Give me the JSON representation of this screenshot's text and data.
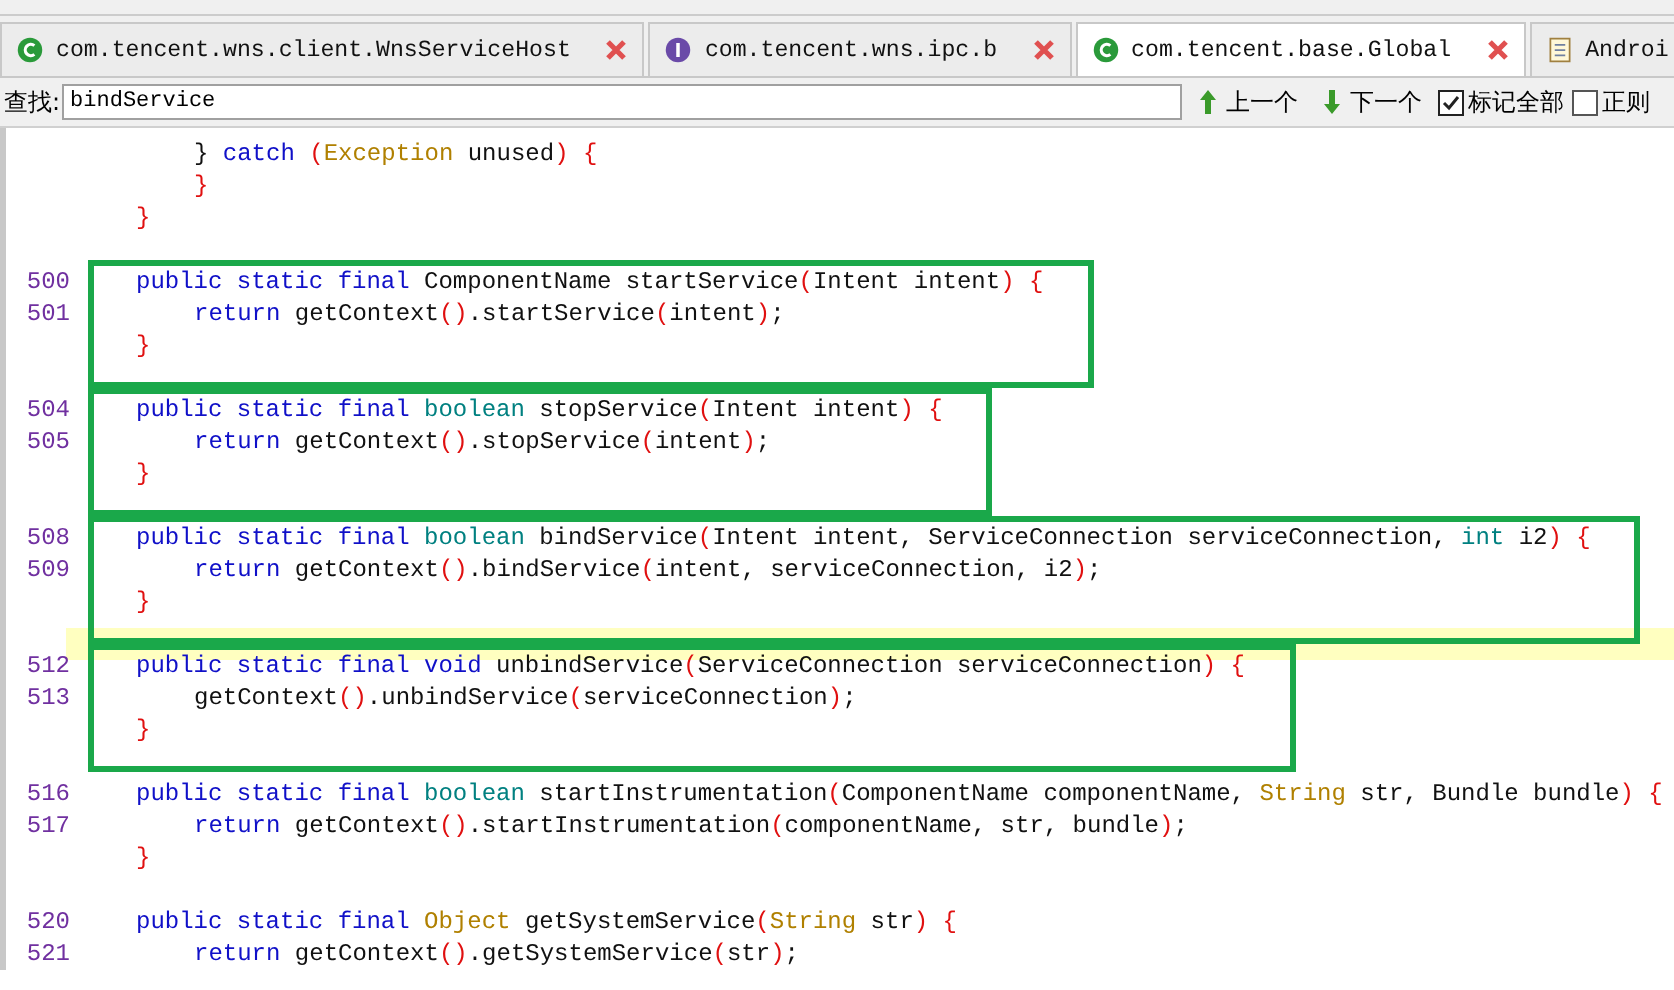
{
  "tabs": [
    {
      "label": "com.tencent.wns.client.WnsServiceHost",
      "kind": "class",
      "selected": false
    },
    {
      "label": "com.tencent.wns.ipc.b",
      "kind": "interface",
      "selected": false
    },
    {
      "label": "com.tencent.base.Global",
      "kind": "class",
      "selected": true
    },
    {
      "label": "Androi",
      "kind": "file",
      "selected": false
    }
  ],
  "search": {
    "label": "查找:",
    "value": "bindService",
    "prev": "上一个",
    "next": "下一个",
    "options": [
      {
        "label": "标记全部",
        "checked": true
      },
      {
        "label": "正则",
        "checked": false
      }
    ]
  },
  "code": [
    {
      "boxed": false,
      "lines": [
        {
          "indented": true,
          "tokens": [
            {
              "kind": "plain",
              "text": "} "
            },
            {
              "kind": "kw",
              "text": "catch"
            },
            {
              "kind": "paren",
              "text": " ("
            },
            {
              "kind": "ref",
              "text": "Exception"
            },
            {
              "kind": "plain",
              "text": " unused"
            },
            {
              "kind": "paren",
              "text": ")"
            },
            {
              "kind": "paren",
              "text": " {"
            }
          ]
        },
        {
          "indented": true,
          "tokens": [
            {
              "kind": "paren",
              "text": "}"
            }
          ]
        },
        {
          "indented": false,
          "tokens": [
            {
              "kind": "paren",
              "text": "}"
            }
          ]
        }
      ]
    },
    {
      "boxed": true,
      "lines": [
        {
          "number": "500",
          "indented": false,
          "tokens": [
            {
              "kind": "kw",
              "text": "public static final"
            },
            {
              "kind": "plain",
              "text": " ComponentName startService"
            },
            {
              "kind": "paren",
              "text": "("
            },
            {
              "kind": "plain",
              "text": "Intent intent"
            },
            {
              "kind": "paren",
              "text": ")"
            },
            {
              "kind": "paren",
              "text": " {"
            }
          ]
        },
        {
          "number": "501",
          "indented": true,
          "tokens": [
            {
              "kind": "kw",
              "text": "return"
            },
            {
              "kind": "plain",
              "text": " getContext"
            },
            {
              "kind": "paren",
              "text": "()"
            },
            {
              "kind": "plain",
              "text": ".startService"
            },
            {
              "kind": "paren",
              "text": "("
            },
            {
              "kind": "plain",
              "text": "intent"
            },
            {
              "kind": "paren",
              "text": ")"
            },
            {
              "kind": "plain",
              "text": ";"
            }
          ]
        },
        {
          "indented": false,
          "tokens": [
            {
              "kind": "paren",
              "text": "}"
            }
          ]
        }
      ]
    },
    {
      "boxed": true,
      "lines": [
        {
          "number": "504",
          "indented": false,
          "tokens": [
            {
              "kind": "kw",
              "text": "public static final"
            },
            {
              "kind": "prim",
              "text": " boolean"
            },
            {
              "kind": "plain",
              "text": " stopService"
            },
            {
              "kind": "paren",
              "text": "("
            },
            {
              "kind": "plain",
              "text": "Intent intent"
            },
            {
              "kind": "paren",
              "text": ")"
            },
            {
              "kind": "paren",
              "text": " {"
            }
          ]
        },
        {
          "number": "505",
          "indented": true,
          "tokens": [
            {
              "kind": "kw",
              "text": "return"
            },
            {
              "kind": "plain",
              "text": " getContext"
            },
            {
              "kind": "paren",
              "text": "()"
            },
            {
              "kind": "plain",
              "text": ".stopService"
            },
            {
              "kind": "paren",
              "text": "("
            },
            {
              "kind": "plain",
              "text": "intent"
            },
            {
              "kind": "paren",
              "text": ")"
            },
            {
              "kind": "plain",
              "text": ";"
            }
          ]
        },
        {
          "indented": false,
          "tokens": [
            {
              "kind": "paren",
              "text": "}"
            }
          ]
        }
      ]
    },
    {
      "boxed": true,
      "lines": [
        {
          "number": "508",
          "indented": false,
          "tokens": [
            {
              "kind": "kw",
              "text": "public static final"
            },
            {
              "kind": "prim",
              "text": " boolean"
            },
            {
              "kind": "plain",
              "text": " bindService"
            },
            {
              "kind": "paren",
              "text": "("
            },
            {
              "kind": "plain",
              "text": "Intent intent, ServiceConnection serviceConnection, "
            },
            {
              "kind": "prim",
              "text": "int"
            },
            {
              "kind": "plain",
              "text": " i2"
            },
            {
              "kind": "paren",
              "text": ")"
            },
            {
              "kind": "paren",
              "text": " {"
            }
          ]
        },
        {
          "number": "509",
          "indented": true,
          "tokens": [
            {
              "kind": "kw",
              "text": "return"
            },
            {
              "kind": "plain",
              "text": " getContext"
            },
            {
              "kind": "paren",
              "text": "()"
            },
            {
              "kind": "plain",
              "text": ".bindService"
            },
            {
              "kind": "paren",
              "text": "("
            },
            {
              "kind": "plain",
              "text": "intent, serviceConnection, i2"
            },
            {
              "kind": "paren",
              "text": ")"
            },
            {
              "kind": "plain",
              "text": ";"
            }
          ]
        },
        {
          "indented": false,
          "tokens": [
            {
              "kind": "paren",
              "text": "}"
            }
          ]
        }
      ]
    },
    {
      "highlighted": true
    },
    {
      "boxed": true,
      "lines": [
        {
          "number": "512",
          "indented": false,
          "tokens": [
            {
              "kind": "kw",
              "text": "public static final void"
            },
            {
              "kind": "plain",
              "text": " unbindService"
            },
            {
              "kind": "paren",
              "text": "("
            },
            {
              "kind": "plain",
              "text": "ServiceConnection serviceConnection"
            },
            {
              "kind": "paren",
              "text": ")"
            },
            {
              "kind": "paren",
              "text": " {"
            }
          ]
        },
        {
          "number": "513",
          "indented": true,
          "tokens": [
            {
              "kind": "plain",
              "text": "getContext"
            },
            {
              "kind": "paren",
              "text": "()"
            },
            {
              "kind": "plain",
              "text": ".unbindService"
            },
            {
              "kind": "paren",
              "text": "("
            },
            {
              "kind": "plain",
              "text": "serviceConnection"
            },
            {
              "kind": "paren",
              "text": ")"
            },
            {
              "kind": "plain",
              "text": ";"
            }
          ]
        },
        {
          "indented": false,
          "tokens": [
            {
              "kind": "paren",
              "text": "}"
            }
          ]
        }
      ]
    },
    {
      "boxed": false,
      "lines": [
        {
          "number": "516",
          "indented": false,
          "tokens": [
            {
              "kind": "kw",
              "text": "public static final"
            },
            {
              "kind": "prim",
              "text": " boolean"
            },
            {
              "kind": "plain",
              "text": " startInstrumentation"
            },
            {
              "kind": "paren",
              "text": "("
            },
            {
              "kind": "plain",
              "text": "ComponentName componentName, "
            },
            {
              "kind": "ref",
              "text": "String"
            },
            {
              "kind": "plain",
              "text": " str, Bundle bundle"
            },
            {
              "kind": "paren",
              "text": ")"
            },
            {
              "kind": "paren",
              "text": " {"
            }
          ]
        },
        {
          "number": "517",
          "indented": true,
          "tokens": [
            {
              "kind": "kw",
              "text": "return"
            },
            {
              "kind": "plain",
              "text": " getContext"
            },
            {
              "kind": "paren",
              "text": "()"
            },
            {
              "kind": "plain",
              "text": ".startInstrumentation"
            },
            {
              "kind": "paren",
              "text": "("
            },
            {
              "kind": "plain",
              "text": "componentName, str, bundle"
            },
            {
              "kind": "paren",
              "text": ")"
            },
            {
              "kind": "plain",
              "text": ";"
            }
          ]
        },
        {
          "indented": false,
          "tokens": [
            {
              "kind": "paren",
              "text": "}"
            }
          ]
        }
      ]
    },
    {
      "boxed": false,
      "lines": [
        {
          "number": "520",
          "indented": false,
          "tokens": [
            {
              "kind": "kw",
              "text": "public static final"
            },
            {
              "kind": "ref",
              "text": " Object"
            },
            {
              "kind": "plain",
              "text": " getSystemService"
            },
            {
              "kind": "paren",
              "text": "("
            },
            {
              "kind": "ref",
              "text": "String"
            },
            {
              "kind": "plain",
              "text": " str"
            },
            {
              "kind": "paren",
              "text": ")"
            },
            {
              "kind": "paren",
              "text": " {"
            }
          ]
        },
        {
          "number": "521",
          "indented": true,
          "tokens": [
            {
              "kind": "kw",
              "text": "return"
            },
            {
              "kind": "plain",
              "text": " getContext"
            },
            {
              "kind": "paren",
              "text": "()"
            },
            {
              "kind": "plain",
              "text": ".getSystemService"
            },
            {
              "kind": "paren",
              "text": "("
            },
            {
              "kind": "plain",
              "text": "str"
            },
            {
              "kind": "paren",
              "text": ")"
            },
            {
              "kind": "plain",
              "text": ";"
            }
          ]
        }
      ]
    }
  ]
}
